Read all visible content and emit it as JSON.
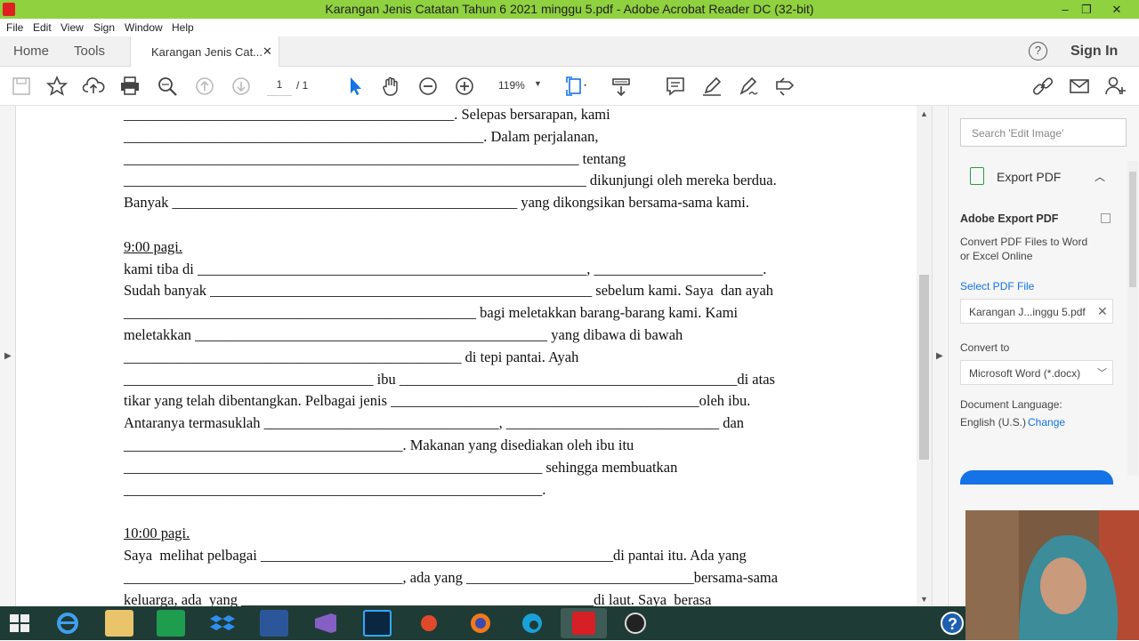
{
  "window": {
    "title": "Karangan Jenis Catatan Tahun 6 2021 minggu 5.pdf - Adobe Acrobat Reader DC (32-bit)",
    "minimize": "–",
    "maximize": "❐",
    "close": "✕"
  },
  "menubar": {
    "items": [
      "File",
      "Edit",
      "View",
      "Sign",
      "Window",
      "Help"
    ]
  },
  "tabs": {
    "home": "Home",
    "tools": "Tools",
    "document": "Karangan Jenis Cat...",
    "close": "✕",
    "help": "?",
    "signin": "Sign In"
  },
  "toolbar": {
    "page_current": "1",
    "page_total": "/ 1",
    "zoom": "119%",
    "icons": [
      "save-icon",
      "star-icon",
      "upload-icon",
      "print-icon",
      "search-icon",
      "page-up-icon",
      "page-down-icon",
      "select-icon",
      "hand-icon",
      "zoom-out-icon",
      "zoom-in-icon",
      "fit-page-icon",
      "scroll-mode-icon",
      "comment-icon",
      "highlight-icon",
      "sign-icon",
      "tools-more-icon",
      "link-icon",
      "email-icon",
      "add-user-icon"
    ]
  },
  "document": {
    "lines": [
      "_____________________________________________. Selepas bersarapan, kami",
      "_________________________________________________. Dalam perjalanan,",
      "______________________________________________________________ tentang",
      "_______________________________________________________________ dikunjungi oleh mereka berdua.",
      "Banyak _______________________________________________ yang dikongsikan bersama-sama kami.",
      "",
      "9:00 pagi.",
      "kami tiba di _____________________________________________________, _______________________.",
      "Sudah banyak ____________________________________________________ sebelum kami. Saya  dan ayah",
      "________________________________________________ bagi meletakkan barang-barang kami. Kami",
      "meletakkan ________________________________________________ yang dibawa di bawah",
      "______________________________________________ di tepi pantai. Ayah",
      "__________________________________ ibu ______________________________________________di atas",
      "tikar yang telah dibentangkan. Pelbagai jenis __________________________________________oleh ibu.",
      "Antaranya termasuklah ________________________________, _____________________________ dan",
      "______________________________________. Makanan yang disediakan oleh ibu itu",
      "_________________________________________________________ sehingga membuatkan",
      "_________________________________________________________.",
      "",
      "10:00 pagi.",
      "Saya  melihat pelbagai ________________________________________________di pantai itu. Ada yang",
      "______________________________________, ada yang _______________________________bersama-sama",
      "keluarga, ada  yang ________________________________________________di laut. Saya  berasa"
    ]
  },
  "rightpanel": {
    "search_placeholder": "Search 'Edit Image'",
    "export_title": "Export PDF",
    "adobe_export_heading": "Adobe Export PDF",
    "description_line1": "Convert PDF Files to Word",
    "description_line2": "or Excel Online",
    "select_label": "Select PDF File",
    "selected_file": "Karangan J...inggu 5.pdf",
    "convert_label": "Convert to",
    "convert_value": "Microsoft Word (*.docx)",
    "language_label": "Document Language:",
    "language_value": "English (U.S.)",
    "language_change": "Change"
  },
  "colors": {
    "titlebar": "#8fd13f",
    "accent_blue": "#1473e6",
    "taskbar": "#1f3b36"
  }
}
